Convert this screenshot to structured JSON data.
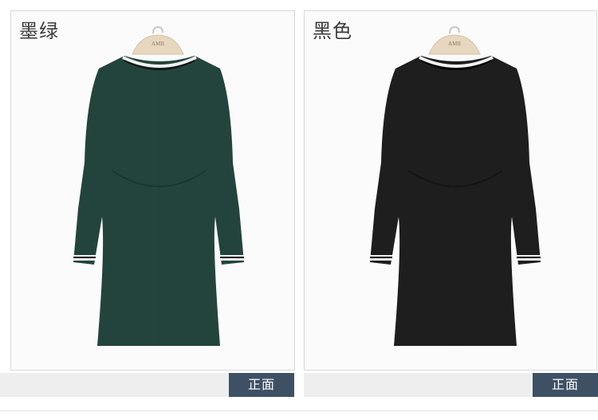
{
  "products": [
    {
      "color_name": "墨绿",
      "view_label": "正面",
      "hanger_text": "AMII",
      "icon": "dress-image",
      "dress_color": "#23443c"
    },
    {
      "color_name": "黑色",
      "view_label": "正面",
      "hanger_text": "AMII",
      "icon": "dress-image",
      "dress_color": "#1e1e1e"
    }
  ]
}
